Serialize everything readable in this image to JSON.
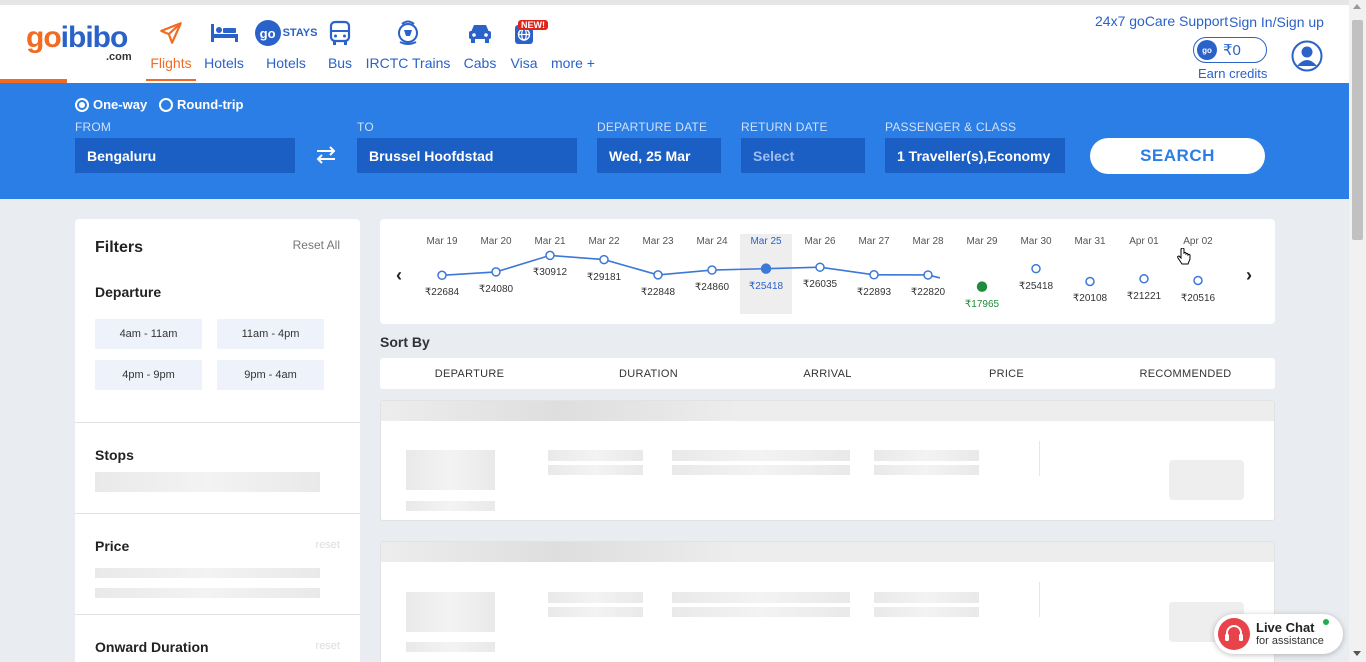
{
  "header": {
    "logo_go": "go",
    "logo_ibibo": "ibibo",
    "logo_com": ".com",
    "nav": [
      {
        "label": "Flights",
        "icon": "airplane-icon"
      },
      {
        "label": "Hotels",
        "icon": "bed-icon"
      },
      {
        "label": "Hotels",
        "icon": "gostays-icon",
        "logo_go": "go",
        "logo_stays": "STAYS"
      },
      {
        "label": "Bus",
        "icon": "bus-icon"
      },
      {
        "label": "IRCTC Trains",
        "icon": "irctc-icon"
      },
      {
        "label": "Cabs",
        "icon": "car-icon"
      },
      {
        "label": "Visa",
        "icon": "globe-icon",
        "badge": "NEW!"
      },
      {
        "label": "more +"
      }
    ],
    "support": "24x7 goCare Support",
    "signin": "Sign In/Sign up",
    "credits_logo": "go",
    "credits_amount": "₹0",
    "earn_credits": "Earn credits"
  },
  "search": {
    "trip_oneway": "One-way",
    "trip_round": "Round-trip",
    "from_label": "FROM",
    "from_value": "Bengaluru",
    "to_label": "TO",
    "to_value": "Brussel Hoofdstad",
    "departure_label": "DEPARTURE DATE",
    "departure_value": "Wed, 25 Mar",
    "return_label": "RETURN DATE",
    "return_placeholder": "Select",
    "passenger_label": "PASSENGER & CLASS",
    "passenger_value": "1 Traveller(s),Economy",
    "search_button": "SEARCH"
  },
  "filters": {
    "title": "Filters",
    "reset_all": "Reset All",
    "departure_title": "Departure",
    "departure_slots": [
      "4am - 11am",
      "11am - 4pm",
      "4pm - 9pm",
      "9pm - 4am"
    ],
    "stops_title": "Stops",
    "price_title": "Price",
    "price_reset": "reset",
    "duration_title": "Onward Duration",
    "duration_reset": "reset"
  },
  "fare_calendar": {
    "dates": [
      {
        "label": "Mar 19",
        "price": "₹22684",
        "value": 22684
      },
      {
        "label": "Mar 20",
        "price": "₹24080",
        "value": 24080
      },
      {
        "label": "Mar 21",
        "price": "₹30912",
        "value": 30912
      },
      {
        "label": "Mar 22",
        "price": "₹29181",
        "value": 29181
      },
      {
        "label": "Mar 23",
        "price": "₹22848",
        "value": 22848
      },
      {
        "label": "Mar 24",
        "price": "₹24860",
        "value": 24860
      },
      {
        "label": "Mar 25",
        "price": "₹25418",
        "value": 25418,
        "selected": true
      },
      {
        "label": "Mar 26",
        "price": "₹26035",
        "value": 26035
      },
      {
        "label": "Mar 27",
        "price": "₹22893",
        "value": 22893
      },
      {
        "label": "Mar 28",
        "price": "₹22820",
        "value": 22820
      },
      {
        "label": "Mar 29",
        "price": "₹17965",
        "value": 17965,
        "cheapest": true
      },
      {
        "label": "Mar 30",
        "price": "₹25418",
        "value": 25418
      },
      {
        "label": "Mar 31",
        "price": "₹20108",
        "value": 20108
      },
      {
        "label": "Apr 01",
        "price": "₹21221",
        "value": 21221
      },
      {
        "label": "Apr 02",
        "price": "₹20516",
        "value": 20516
      }
    ],
    "line_color": "#3c78d8",
    "cheapest_color": "#1e8c3a"
  },
  "sort": {
    "title": "Sort By",
    "options": [
      "DEPARTURE",
      "DURATION",
      "ARRIVAL",
      "PRICE",
      "RECOMMENDED"
    ]
  },
  "livechat": {
    "title": "Live Chat",
    "subtitle": "for assistance"
  }
}
